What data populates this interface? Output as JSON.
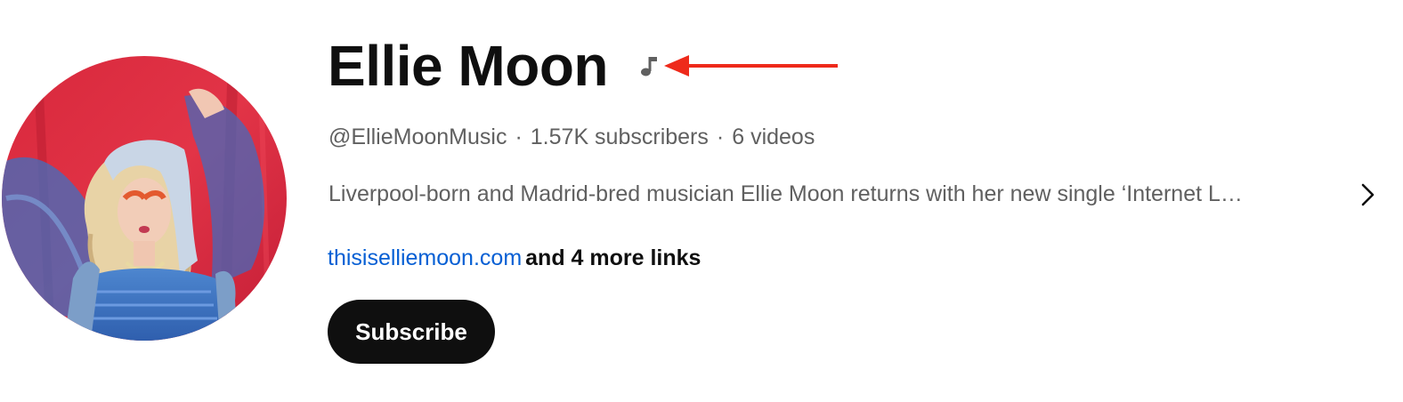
{
  "channel": {
    "name": "Ellie Moon",
    "handle": "@EllieMoonMusic",
    "subscribers": "1.57K subscribers",
    "videos": "6 videos",
    "separator": "·",
    "description": "Liverpool-born and Madrid-bred musician Ellie Moon returns with her new single ‘Internet L…",
    "badge_icon": "music-note-icon",
    "avatar_icon": "channel-avatar"
  },
  "links": {
    "primary": "thisiselliemoon.com",
    "more": "and 4 more links"
  },
  "actions": {
    "subscribe_label": "Subscribe",
    "expand_icon": "chevron-right-icon"
  },
  "annotation": {
    "arrow_icon": "red-arrow-icon",
    "arrow_color": "#ee2a1b"
  },
  "colors": {
    "text_primary": "#0f0f0f",
    "text_secondary": "#606060",
    "link": "#065fd4",
    "button_bg": "#0f0f0f",
    "button_text": "#ffffff"
  }
}
